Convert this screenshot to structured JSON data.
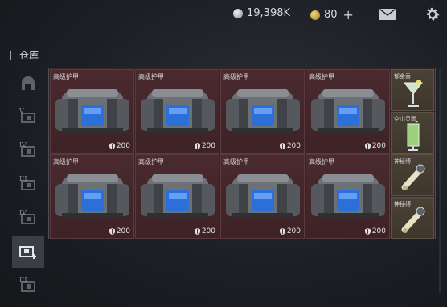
{
  "header": {
    "silver_amount": "19,398K",
    "gold_amount": "80",
    "add_symbol": "+"
  },
  "section": {
    "title": "仓库"
  },
  "sidebar": {
    "tabs": [
      {
        "icon": "helmet-icon",
        "roman": ""
      },
      {
        "icon": "stash-v-icon",
        "roman": "V"
      },
      {
        "icon": "stash-iv-icon",
        "roman": "IV"
      },
      {
        "icon": "stash-iii-icon",
        "roman": "III"
      },
      {
        "icon": "stash-iv-b-icon",
        "roman": "IV"
      },
      {
        "icon": "stash-add-icon",
        "roman": "",
        "active": true
      },
      {
        "icon": "stash-iii-b-icon",
        "roman": "III"
      }
    ]
  },
  "items": [
    {
      "name": "高级护甲",
      "durability": "200"
    },
    {
      "name": "高级护甲",
      "durability": "200"
    },
    {
      "name": "高级护甲",
      "durability": "200"
    },
    {
      "name": "高级护甲",
      "durability": "200"
    },
    {
      "name": "高级护甲",
      "durability": "200"
    },
    {
      "name": "高级护甲",
      "durability": "200"
    },
    {
      "name": "高级护甲",
      "durability": "200"
    },
    {
      "name": "高级护甲",
      "durability": "200"
    }
  ],
  "small_items": [
    {
      "name": "郁金香",
      "icon": "cocktail-glass-icon"
    },
    {
      "name": "空山灵雨",
      "icon": "tall-glass-icon"
    },
    {
      "name": "神秘缚",
      "icon": "scroll-icon"
    },
    {
      "name": "神秘缚",
      "icon": "scroll-icon"
    }
  ]
}
